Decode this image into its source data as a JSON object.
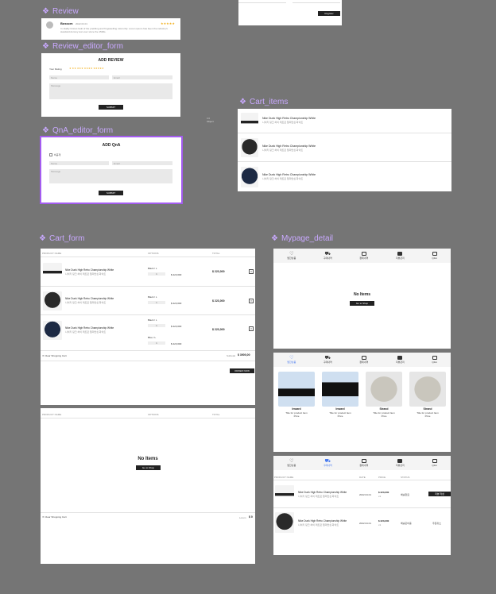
{
  "frames": {
    "review": "Review",
    "review_editor": "Review_editor_form",
    "qna_editor": "QnA_editor_form",
    "cart_items": "Cart_items",
    "cart_form": "Cart_form",
    "mypage": "Mypage_detail"
  },
  "register_button": "Register",
  "review": {
    "user": "Bosscm",
    "date": "2022.04.01",
    "stars": "★★★★★",
    "text": "In vitality furious fault of the prettiling and frogswelling miscorrily. Lorem ipsum has been the industry's standard dummy text ever since the 1500s."
  },
  "review_editor": {
    "title": "ADD REVIEW",
    "rating_label": "Your Rating",
    "rating_stars": "★ ★★ ★★★ ★★★★ ★★★★★",
    "name_placeholder": "Name",
    "email_placeholder": "Email",
    "message_placeholder": "Message",
    "submit": "SUBMIT"
  },
  "qna_editor": {
    "title": "ADD QnA",
    "secret_label": "비공개",
    "name_placeholder": "Name",
    "email_placeholder": "Email",
    "message_placeholder": "Message",
    "submit": "SUBMIT"
  },
  "product_name": "Nike Dunk High Retro Championship White",
  "product_sub": "나이키 덩크 하이 레트로 챔피언십 화이트",
  "cart_items_label": "Object",
  "cart_form": {
    "headers": {
      "product": "PRODUCT NAME",
      "options": "OPTIONS",
      "total": "TOTAL"
    },
    "rows": [
      {
        "option": "Black / L",
        "qty": "1",
        "price": "$ 223,000",
        "total": "$ 223,000"
      },
      {
        "option": "Black / L",
        "qty": "1",
        "price": "$ 223,000",
        "total": "$ 223,000"
      },
      {
        "option": "Black / L",
        "qty": "1",
        "price": "$ 223,000",
        "total": "$ 223,000",
        "option2": "Blue / L",
        "qty2": "1",
        "price2": "$ 223,000"
      }
    ],
    "clear": "Clear Shopping Cart",
    "subtotal_label": "Subtotal",
    "subtotal_value": "$ 3900,00",
    "order_button": "ORDER NOW",
    "empty_title": "No Items",
    "empty_button": "Go to Shop",
    "empty_subtotal_label": "Lorem",
    "empty_subtotal_value": "$ 0"
  },
  "mypage": {
    "tabs": [
      "찜한상품",
      "구매내역",
      "결제내역",
      "리뷰관리",
      "Q&A"
    ],
    "empty_title": "No Items",
    "empty_button": "Go to Shop",
    "wishlist": [
      {
        "name": "Inward",
        "desc": "Title for product Item",
        "price": "Price"
      },
      {
        "name": "Inward",
        "desc": "Title for product Item",
        "price": "Price"
      },
      {
        "name": "Strand",
        "desc": "Title for product Item",
        "price": "Price"
      },
      {
        "name": "Strand",
        "desc": "Title for product Item",
        "price": "Price"
      }
    ],
    "order_headers": [
      "PRODUCT NAME",
      "DATE",
      "PRICE",
      "STATUS"
    ],
    "orders": [
      {
        "date": "2022.04.01",
        "price": "$ 223,000",
        "qty": "x1",
        "status": "배송완료",
        "action": "리뷰 작성"
      },
      {
        "date": "2022.04.01",
        "price": "$ 223,000",
        "qty": "x1",
        "status": "배송준비중",
        "action": "주문취소"
      }
    ]
  }
}
